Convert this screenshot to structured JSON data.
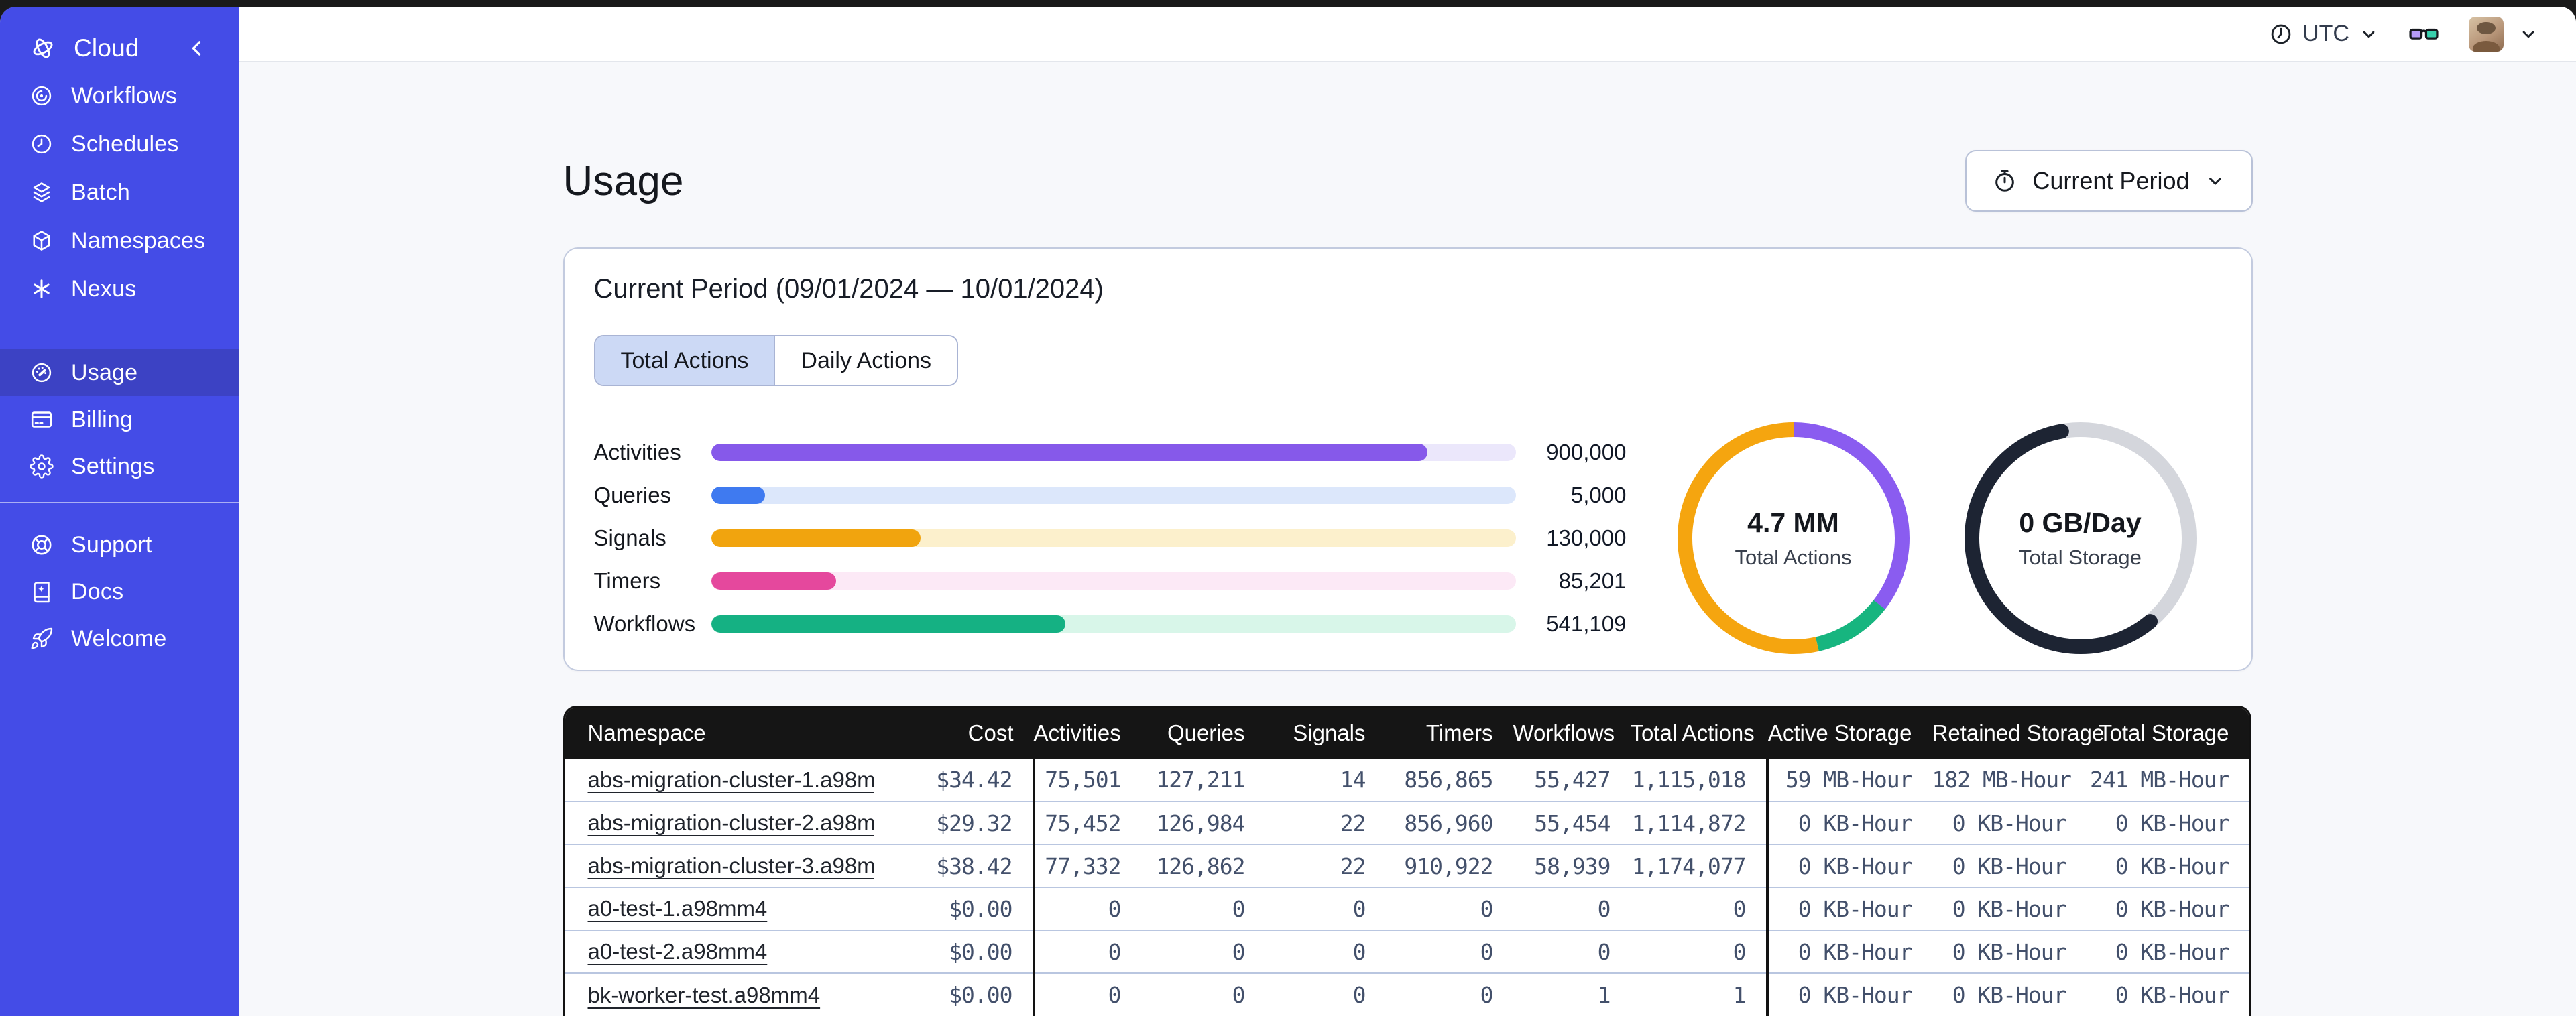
{
  "sidebar": {
    "brand": "Cloud",
    "main": [
      {
        "label": "Workflows",
        "icon": "workflows"
      },
      {
        "label": "Schedules",
        "icon": "schedules"
      },
      {
        "label": "Batch",
        "icon": "batch"
      },
      {
        "label": "Namespaces",
        "icon": "namespaces"
      },
      {
        "label": "Nexus",
        "icon": "nexus"
      }
    ],
    "account": [
      {
        "label": "Usage",
        "icon": "usage",
        "active": true
      },
      {
        "label": "Billing",
        "icon": "billing"
      },
      {
        "label": "Settings",
        "icon": "settings"
      }
    ],
    "footer": [
      {
        "label": "Support",
        "icon": "support"
      },
      {
        "label": "Docs",
        "icon": "docs"
      },
      {
        "label": "Welcome",
        "icon": "welcome"
      }
    ]
  },
  "topbar": {
    "timezone": "UTC"
  },
  "page": {
    "title": "Usage",
    "period_selector": "Current Period"
  },
  "card": {
    "title": "Current Period (09/01/2024 — 10/01/2024)",
    "tabs": [
      {
        "label": "Total Actions"
      },
      {
        "label": "Daily Actions"
      }
    ],
    "active_tab": 0
  },
  "chart_data": {
    "type": "bar",
    "title": "Current Period (09/01/2024 — 10/01/2024)",
    "categories": [
      "Activities",
      "Queries",
      "Signals",
      "Timers",
      "Workflows"
    ],
    "values": [
      900000,
      5000,
      130000,
      85201,
      541109
    ],
    "bars": [
      {
        "label": "Activities",
        "value": 900000,
        "display_value": "900,000",
        "fill_pct": 89,
        "color": "#8659ea",
        "track_color": "#ebe7fb"
      },
      {
        "label": "Queries",
        "value": 5000,
        "display_value": "5,000",
        "fill_pct": 6.7,
        "color": "#3f7af0",
        "track_color": "#dce7fb"
      },
      {
        "label": "Signals",
        "value": 130000,
        "display_value": "130,000",
        "fill_pct": 26,
        "color": "#f1a40e",
        "track_color": "#fcf0cc"
      },
      {
        "label": "Timers",
        "value": 85201,
        "display_value": "85,201",
        "fill_pct": 15.5,
        "color": "#e5489d",
        "track_color": "#fce9f6"
      },
      {
        "label": "Workflows",
        "value": 541109,
        "display_value": "541,109",
        "fill_pct": 44,
        "color": "#15b183",
        "track_color": "#d8f6e9"
      }
    ],
    "donuts": [
      {
        "value": "4.7 MM",
        "label": "Total Actions",
        "segments": [
          {
            "name": "purple-share",
            "color": "#8a5cf0",
            "pct": 35.5
          },
          {
            "name": "green-share",
            "color": "#17b57f",
            "pct": 11
          },
          {
            "name": "orange-share",
            "color": "#f5a50f",
            "pct": 53.5
          }
        ]
      },
      {
        "value": "0 GB/Day",
        "label": "Total Storage",
        "base": "#d4d6dc",
        "segments": [
          {
            "name": "storage-arc",
            "color": "#1d2433",
            "pct": 58.3,
            "start_pct": 38.9,
            "round": true
          }
        ]
      }
    ]
  },
  "table": {
    "columns": [
      "Namespace",
      "Cost",
      "Activities",
      "Queries",
      "Signals",
      "Timers",
      "Workflows",
      "Total Actions",
      "Active Storage",
      "Retained Storage",
      "Total Storage"
    ],
    "rows": [
      [
        "abs-migration-cluster-1.a98mm4",
        "$34.42",
        "75,501",
        "127,211",
        "14",
        "856,865",
        "55,427",
        "1,115,018",
        "59 MB-Hour",
        "182 MB-Hour",
        "241 MB-Hour"
      ],
      [
        "abs-migration-cluster-2.a98mm4",
        "$29.32",
        "75,452",
        "126,984",
        "22",
        "856,960",
        "55,454",
        "1,114,872",
        "0 KB-Hour",
        "0 KB-Hour",
        "0 KB-Hour"
      ],
      [
        "abs-migration-cluster-3.a98mm4",
        "$38.42",
        "77,332",
        "126,862",
        "22",
        "910,922",
        "58,939",
        "1,174,077",
        "0 KB-Hour",
        "0 KB-Hour",
        "0 KB-Hour"
      ],
      [
        "a0-test-1.a98mm4",
        "$0.00",
        "0",
        "0",
        "0",
        "0",
        "0",
        "0",
        "0 KB-Hour",
        "0 KB-Hour",
        "0 KB-Hour"
      ],
      [
        "a0-test-2.a98mm4",
        "$0.00",
        "0",
        "0",
        "0",
        "0",
        "0",
        "0",
        "0 KB-Hour",
        "0 KB-Hour",
        "0 KB-Hour"
      ],
      [
        "bk-worker-test.a98mm4",
        "$0.00",
        "0",
        "0",
        "0",
        "0",
        "1",
        "1",
        "0 KB-Hour",
        "0 KB-Hour",
        "0 KB-Hour"
      ]
    ]
  }
}
